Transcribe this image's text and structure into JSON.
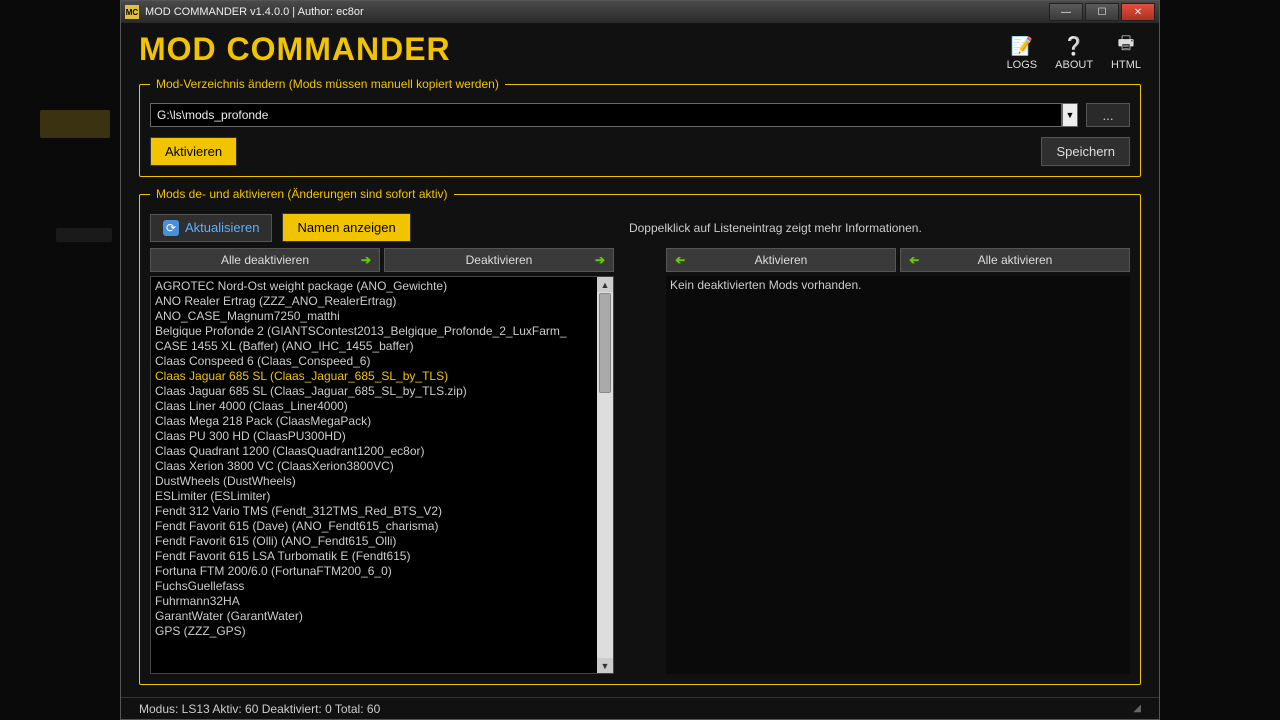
{
  "window": {
    "title": "MOD COMMANDER v1.4.0.0 | Author: ec8or"
  },
  "header": {
    "app_title": "MOD COMMANDER",
    "icons": {
      "logs": "LOGS",
      "about": "ABOUT",
      "html": "HTML"
    }
  },
  "directory_box": {
    "legend": "Mod-Verzeichnis ändern (Mods müssen manuell kopiert werden)",
    "path": "G:\\ls\\mods_profonde",
    "activate": "Aktivieren",
    "save": "Speichern",
    "browse": "..."
  },
  "mods_box": {
    "legend": "Mods de- und aktivieren (Änderungen sind sofort aktiv)",
    "refresh": "Aktualisieren",
    "show_names": "Namen anzeigen",
    "hint": "Doppelklick auf Listeneintrag zeigt mehr Informationen.",
    "left_buttons": {
      "deactivate_all": "Alle deaktivieren",
      "deactivate": "Deaktivieren"
    },
    "right_buttons": {
      "activate": "Aktivieren",
      "activate_all": "Alle aktivieren"
    },
    "right_empty": "Kein deaktivierten Mods vorhanden.",
    "active_list": [
      {
        "label": "AGROTEC Nord-Ost weight package (ANO_Gewichte)"
      },
      {
        "label": "ANO Realer Ertrag (ZZZ_ANO_RealerErtrag)"
      },
      {
        "label": "ANO_CASE_Magnum7250_matthi"
      },
      {
        "label": "Belgique Profonde 2 (GIANTSContest2013_Belgique_Profonde_2_LuxFarm_"
      },
      {
        "label": "CASE 1455 XL (Baffer) (ANO_IHC_1455_baffer)"
      },
      {
        "label": "Claas Conspeed 6 (Claas_Conspeed_6)"
      },
      {
        "label": "Claas Jaguar 685 SL (Claas_Jaguar_685_SL_by_TLS)",
        "highlight": true
      },
      {
        "label": "Claas Jaguar 685 SL (Claas_Jaguar_685_SL_by_TLS.zip)"
      },
      {
        "label": "Claas Liner 4000 (Claas_Liner4000)"
      },
      {
        "label": "Claas Mega 218 Pack (ClaasMegaPack)"
      },
      {
        "label": "Claas PU 300 HD (ClaasPU300HD)"
      },
      {
        "label": "Claas Quadrant 1200 (ClaasQuadrant1200_ec8or)"
      },
      {
        "label": "Claas Xerion 3800 VC (ClaasXerion3800VC)"
      },
      {
        "label": "DustWheels (DustWheels)"
      },
      {
        "label": "ESLimiter (ESLimiter)"
      },
      {
        "label": "Fendt 312 Vario TMS (Fendt_312TMS_Red_BTS_V2)"
      },
      {
        "label": "Fendt Favorit 615 (Dave) (ANO_Fendt615_charisma)"
      },
      {
        "label": "Fendt Favorit 615 (Olli) (ANO_Fendt615_Olli)"
      },
      {
        "label": "Fendt Favorit 615 LSA Turbomatik E (Fendt615)"
      },
      {
        "label": "Fortuna FTM 200/6.0 (FortunaFTM200_6_0)"
      },
      {
        "label": "FuchsGuellefass"
      },
      {
        "label": "Fuhrmann32HA"
      },
      {
        "label": "GarantWater (GarantWater)"
      },
      {
        "label": "GPS (ZZZ_GPS)"
      }
    ]
  },
  "statusbar": {
    "text": "Modus: LS13  Aktiv: 60  Deaktiviert: 0  Total: 60"
  }
}
